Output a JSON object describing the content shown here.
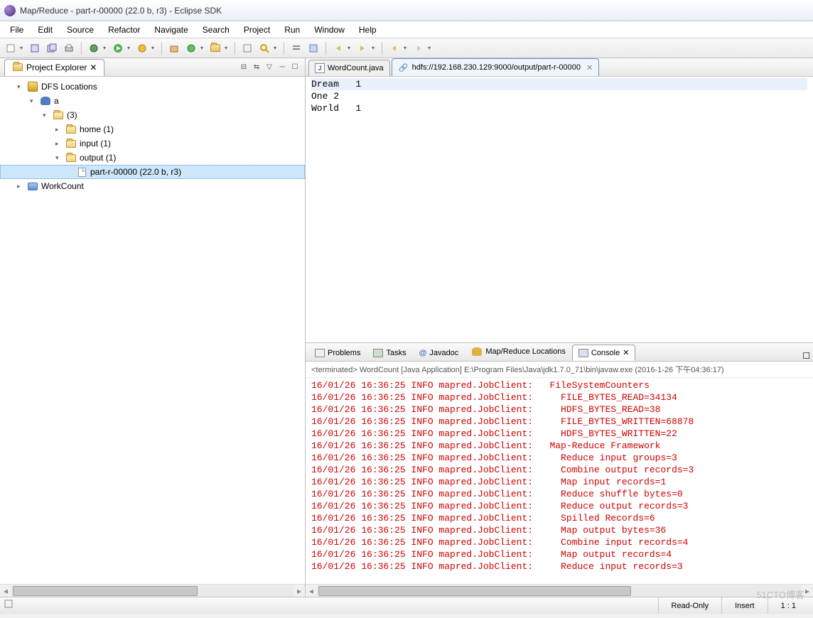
{
  "window": {
    "title": "Map/Reduce - part-r-00000 (22.0 b, r3) - Eclipse SDK"
  },
  "menu": [
    "File",
    "Edit",
    "Source",
    "Refactor",
    "Navigate",
    "Search",
    "Project",
    "Run",
    "Window",
    "Help"
  ],
  "project_explorer": {
    "title": "Project Explorer",
    "tree": {
      "dfs": "DFS Locations",
      "conn": "a",
      "root": "(3)",
      "home": "home (1)",
      "input": "input (1)",
      "output": "output (1)",
      "file": "part-r-00000 (22.0 b, r3)",
      "proj": "WorkCount"
    }
  },
  "editor": {
    "tab1": "WordCount.java",
    "tab2": "hdfs://192.168.230.129:9000/output/part-r-00000",
    "content": "Dream   1\nOne 2\nWorld   1"
  },
  "views": {
    "tabs": [
      "Problems",
      "Tasks",
      "Javadoc",
      "Map/Reduce Locations",
      "Console"
    ],
    "console_head": "<terminated> WordCount [Java Application] E:\\Program Files\\Java\\jdk1.7.0_71\\bin\\javaw.exe (2016-1-26 下午04:36:17)",
    "console_lines": "16/01/26 16:36:25 INFO mapred.JobClient:   FileSystemCounters\n16/01/26 16:36:25 INFO mapred.JobClient:     FILE_BYTES_READ=34134\n16/01/26 16:36:25 INFO mapred.JobClient:     HDFS_BYTES_READ=38\n16/01/26 16:36:25 INFO mapred.JobClient:     FILE_BYTES_WRITTEN=68878\n16/01/26 16:36:25 INFO mapred.JobClient:     HDFS_BYTES_WRITTEN=22\n16/01/26 16:36:25 INFO mapred.JobClient:   Map-Reduce Framework\n16/01/26 16:36:25 INFO mapred.JobClient:     Reduce input groups=3\n16/01/26 16:36:25 INFO mapred.JobClient:     Combine output records=3\n16/01/26 16:36:25 INFO mapred.JobClient:     Map input records=1\n16/01/26 16:36:25 INFO mapred.JobClient:     Reduce shuffle bytes=0\n16/01/26 16:36:25 INFO mapred.JobClient:     Reduce output records=3\n16/01/26 16:36:25 INFO mapred.JobClient:     Spilled Records=6\n16/01/26 16:36:25 INFO mapred.JobClient:     Map output bytes=36\n16/01/26 16:36:25 INFO mapred.JobClient:     Combine input records=4\n16/01/26 16:36:25 INFO mapred.JobClient:     Map output records=4\n16/01/26 16:36:25 INFO mapred.JobClient:     Reduce input records=3"
  },
  "status": {
    "readonly": "Read-Only",
    "insert": "Insert",
    "pos": "1 : 1"
  },
  "watermark": "51CTO博客"
}
